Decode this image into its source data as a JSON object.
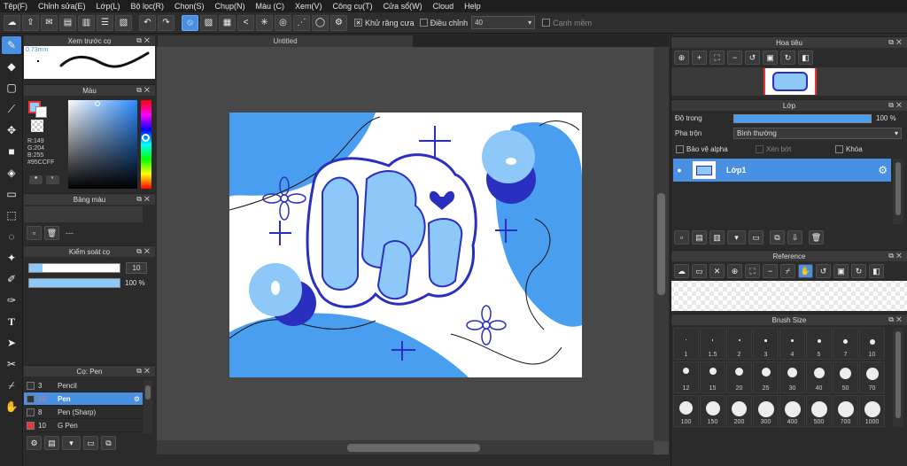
{
  "menu": [
    "Tệp(F)",
    "Chỉnh sửa(E)",
    "Lớp(L)",
    "Bộ lọc(R)",
    "Chọn(S)",
    "Chụp(N)",
    "Màu (C)",
    "Xem(V)",
    "Công cụ(T)",
    "Cửa sổ(W)",
    "Cloud",
    "Help"
  ],
  "toolbar": {
    "antialias_label": "Khử răng cưa",
    "adjust_label": "Điều chỉnh",
    "adjust_value": "40",
    "smooth_label": "Cạnh mềm"
  },
  "preview_panel": {
    "title": "Xem trước cọ",
    "size_text": "0.73mm"
  },
  "color_panel": {
    "title": "Màu",
    "r": "R:149",
    "g": "G:204",
    "b": "B:255",
    "hex": "#95CCFF",
    "current_color": "#95CCFF"
  },
  "palette_panel": {
    "title": "Bảng màu",
    "value": "---"
  },
  "brush_control": {
    "title": "Kiểm soát cọ",
    "size": "10",
    "opacity": "100 %",
    "size_fraction": 0.15,
    "opacity_fraction": 1.0
  },
  "brush_list": {
    "title": "Cọ: Pen",
    "items": [
      {
        "size": "3",
        "name": "Pencil",
        "color": "#333333",
        "selected": false
      },
      {
        "size": "10",
        "name": "Pen",
        "color": "#333333",
        "selected": true
      },
      {
        "size": "8",
        "name": "Pen (Sharp)",
        "color": "#333333",
        "selected": false
      },
      {
        "size": "10",
        "name": "G Pen",
        "color": "#e53935",
        "selected": false
      }
    ]
  },
  "canvas": {
    "tab_title": "Untitled"
  },
  "navigator": {
    "title": "Hoa tiêu"
  },
  "layer_panel": {
    "title": "Lớp",
    "opacity_label": "Độ trong",
    "opacity_value": "100 %",
    "opacity_fraction": 1.0,
    "blend_label": "Pha trộn",
    "blend_value": "Bình thường",
    "protect_alpha": "Bảo vệ alpha",
    "clipping": "Xén bớt",
    "lock": "Khóa",
    "layer_name": "Lớp1"
  },
  "reference": {
    "title": "Reference"
  },
  "brush_size": {
    "title": "Brush Size",
    "sizes": [
      "1",
      "1.5",
      "2",
      "3",
      "4",
      "5",
      "7",
      "10",
      "12",
      "15",
      "20",
      "25",
      "30",
      "40",
      "50",
      "70",
      "100",
      "150",
      "200",
      "300",
      "400",
      "500",
      "700",
      "1000"
    ]
  },
  "colors": {
    "accent": "#4a90e2",
    "art_blue": "#4a9ef0",
    "art_light": "#8ec8f8",
    "art_dark": "#2a2fc0"
  }
}
